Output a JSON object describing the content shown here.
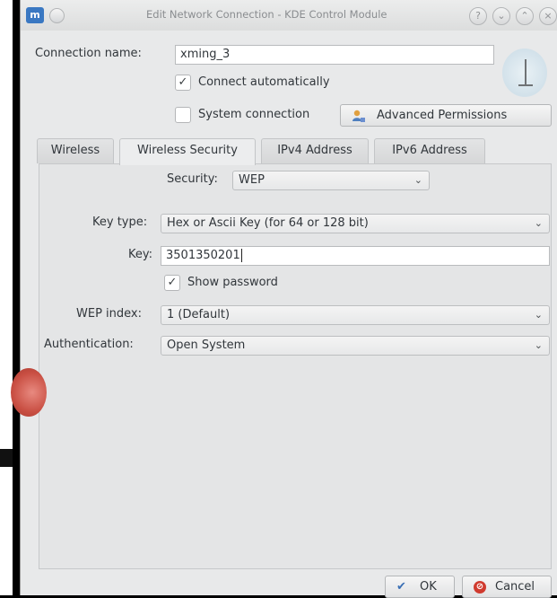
{
  "window": {
    "title": "Edit Network Connection - KDE Control Module"
  },
  "form": {
    "connection_name_label": "Connection name:",
    "connection_name_value": "xming_3",
    "connect_automatically_label": "Connect automatically",
    "connect_automatically_checked": true,
    "system_connection_label": "System connection",
    "system_connection_checked": false,
    "advanced_permissions_label": "Advanced Permissions"
  },
  "tabs": [
    {
      "label": "Wireless",
      "active": false
    },
    {
      "label": "Wireless Security",
      "active": true
    },
    {
      "label": "IPv4 Address",
      "active": false
    },
    {
      "label": "IPv6 Address",
      "active": false
    }
  ],
  "security": {
    "security_label": "Security:",
    "security_value": "WEP",
    "key_type_label": "Key type:",
    "key_type_value": "Hex or Ascii Key (for 64 or 128 bit)",
    "key_label": "Key:",
    "key_value": "3501350201",
    "show_password_label": "Show password",
    "show_password_checked": true,
    "wep_index_label": "WEP index:",
    "wep_index_value": "1 (Default)",
    "authentication_label": "Authentication:",
    "authentication_value": "Open System"
  },
  "footer": {
    "ok_label": "OK",
    "cancel_label": "Cancel"
  },
  "colors": {
    "window_bg": "#e8e9ea",
    "panel_bg": "#e4e5e6",
    "ok_icon": "#3a6fb5",
    "cancel_icon": "#d03b2f"
  },
  "icons": {
    "app": "app-icon",
    "key": "key-icon",
    "permissions": "user-lock-icon",
    "ok": "check-icon",
    "cancel": "cancel-icon",
    "dropdown": "chevron-down-icon"
  }
}
